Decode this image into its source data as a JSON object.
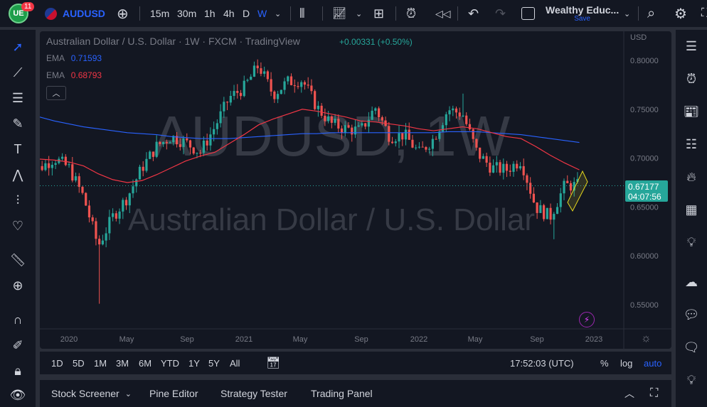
{
  "topbar": {
    "notifications": "11",
    "symbol": "AUDUSD",
    "intervals": [
      "15m",
      "30m",
      "1h",
      "4h",
      "D",
      "W"
    ],
    "active_interval": "W",
    "layout_name": "Wealthy Educ...",
    "save_label": "Save"
  },
  "legend": {
    "title": "Australian Dollar / U.S. Dollar · 1W · FXCM · TradingView",
    "change": "+0.00331 (+0.50%)",
    "ema1_label": "EMA",
    "ema1_value": "0.71593",
    "ema2_label": "EMA",
    "ema2_value": "0.68793"
  },
  "watermark": {
    "symbol": "AUDUSD, 1W",
    "name": "Australian Dollar / U.S. Dollar"
  },
  "price_axis": {
    "currency": "USD",
    "ticks": [
      "0.80000",
      "0.75000",
      "0.70000",
      "0.65000",
      "0.60000",
      "0.55000"
    ],
    "last_price": "0.67177",
    "countdown": "04:07:56"
  },
  "time_axis": [
    "2020",
    "May",
    "Sep",
    "2021",
    "May",
    "Sep",
    "2022",
    "May",
    "Sep",
    "2023"
  ],
  "bottom_toolbar": {
    "ranges": [
      "1D",
      "5D",
      "1M",
      "3M",
      "6M",
      "YTD",
      "1Y",
      "5Y",
      "All"
    ],
    "clock": "17:52:03 (UTC)",
    "percent": "%",
    "log": "log",
    "auto": "auto"
  },
  "panel_tabs": [
    "Stock Screener",
    "Pine Editor",
    "Strategy Tester",
    "Trading Panel"
  ],
  "colors": {
    "up": "#26a69a",
    "down": "#ef5350",
    "ema_blue": "#2962ff",
    "ema_red": "#f23645",
    "accent": "#2962ff"
  },
  "chart_data": {
    "type": "candlestick",
    "ylim": [
      0.53,
      0.815
    ],
    "monthly_close": [
      0.685,
      0.69,
      0.7,
      0.69,
      0.66,
      0.61,
      0.64,
      0.66,
      0.69,
      0.712,
      0.722,
      0.716,
      0.706,
      0.732,
      0.762,
      0.772,
      0.795,
      0.765,
      0.778,
      0.78,
      0.752,
      0.735,
      0.73,
      0.728,
      0.752,
      0.722,
      0.724,
      0.705,
      0.72,
      0.75,
      0.745,
      0.705,
      0.69,
      0.688,
      0.698,
      0.65,
      0.64,
      0.672,
      0.672
    ],
    "lows": {
      "2020-03": 0.551,
      "2022-10": 0.617
    },
    "highs": {
      "2021-02": 0.801,
      "2022-04": 0.766
    },
    "ema_blue": [
      0.745,
      0.742,
      0.738,
      0.735,
      0.732,
      0.73,
      0.728,
      0.726,
      0.725,
      0.724,
      0.722,
      0.721,
      0.72,
      0.72,
      0.72,
      0.721,
      0.722,
      0.723,
      0.724,
      0.725,
      0.725,
      0.726,
      0.726,
      0.726,
      0.726,
      0.726,
      0.726,
      0.726,
      0.726,
      0.727,
      0.727,
      0.727,
      0.726,
      0.725,
      0.724,
      0.722,
      0.72,
      0.718,
      0.716
    ],
    "ema_red": [
      0.7,
      0.699,
      0.698,
      0.696,
      0.692,
      0.684,
      0.678,
      0.675,
      0.677,
      0.683,
      0.69,
      0.697,
      0.702,
      0.706,
      0.715,
      0.724,
      0.734,
      0.74,
      0.745,
      0.75,
      0.748,
      0.745,
      0.742,
      0.738,
      0.737,
      0.735,
      0.733,
      0.73,
      0.728,
      0.73,
      0.732,
      0.73,
      0.726,
      0.722,
      0.72,
      0.712,
      0.703,
      0.695,
      0.688
    ]
  }
}
